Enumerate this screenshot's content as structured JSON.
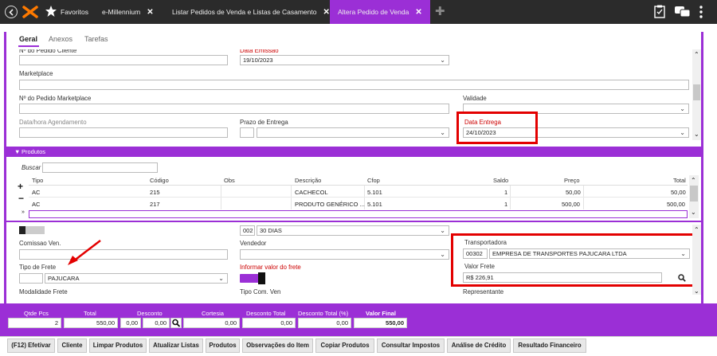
{
  "tabs": {
    "favoritos": "Favoritos",
    "emillennium": "e-Millennium",
    "listar": "Listar Pedidos de Venda e Listas de Casamento",
    "altera": "Altera Pedido de Venda"
  },
  "subtabs": [
    "Geral",
    "Anexos",
    "Tarefas"
  ],
  "form": {
    "cliente_label": "Nº do Pedido Cliente",
    "emissao_label": "Data Emissão",
    "emissao_value": "19/10/2023",
    "marketplace_label": "Marketplace",
    "pedido_marketplace_label": "Nº do Pedido Marketplace",
    "validade_label": "Validade",
    "agendamento_label": "Data/hora Agendamento",
    "prazo_label": "Prazo de Entrega",
    "data_entrega_label": "Data Entrega",
    "data_entrega_value": "24/10/2023"
  },
  "produtos": {
    "header": "Produtos",
    "buscar": "Buscar",
    "columns": [
      "Tipo",
      "Código",
      "Obs",
      "Descrição",
      "Cfop",
      "Saldo",
      "Preço",
      "Total"
    ],
    "rows": [
      [
        "AC",
        "215",
        "",
        "CACHECOL",
        "5.101",
        "1",
        "50,00",
        "50,00"
      ],
      [
        "AC",
        "217",
        "",
        "PRODUTO GENÉRICO ...",
        "5.101",
        "1",
        "500,00",
        "500,00"
      ]
    ]
  },
  "lower": {
    "cond_code": "002",
    "cond_name": "30 DIAS",
    "comissao_label": "Comissao Ven.",
    "vendedor_label": "Vendedor",
    "transportadora_label": "Transportadora",
    "transp_code": "00302",
    "transp_name": "EMPRESA DE TRANSPORTES PAJUCARA LTDA",
    "tipo_frete_label": "Tipo de Frete",
    "tipo_frete_value": "PAJUCARA",
    "informar_frete_label": "Informar valor do frete",
    "valor_frete_label": "Valor Frete",
    "valor_frete_value": "R$ 226,91",
    "modalidade_label": "Modalidade Frete",
    "tipo_com_label": "Tipo Com. Ven",
    "representante_label": "Representante"
  },
  "totals": {
    "qtde_label": "Qtde Pcs",
    "qtde": "2",
    "total_label": "Total",
    "total": "550,00",
    "desconto_label": "Desconto",
    "desc1": "0,00",
    "desc2": "0,00",
    "cortesia_label": "Cortesia",
    "cortesia": "0,00",
    "desc_total_label": "Desconto Total",
    "desc_total": "0,00",
    "desc_pct_label": "Desconto Total (%)",
    "desc_pct": "0,00",
    "valor_final_label": "Valor Final",
    "valor_final": "550,00"
  },
  "buttons": [
    "(F12) Efetivar",
    "Cliente",
    "Limpar Produtos",
    "Atualizar Listas",
    "Produtos",
    "Observações do Item",
    "Copiar Produtos",
    "Consultar Impostos",
    "Análise de Crédito",
    "Resultado Financeiro"
  ]
}
